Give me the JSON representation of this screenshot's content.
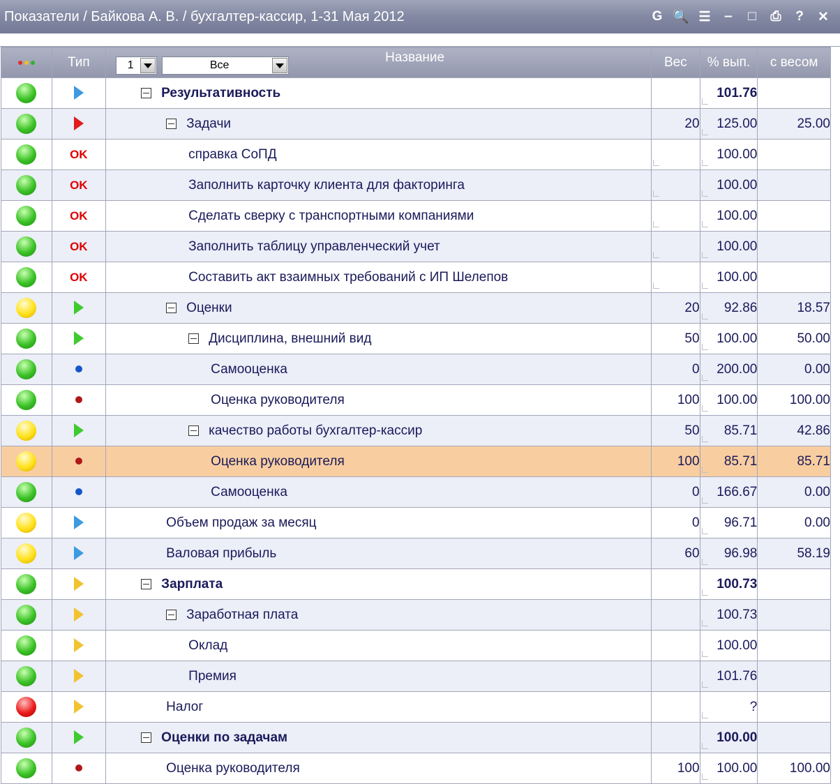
{
  "window": {
    "title": "Показатели / Байкова А. В. / бухгалтер-кассир, 1-31 Мая 2012",
    "toolbar": [
      {
        "name": "refresh-icon",
        "glyph": "G"
      },
      {
        "name": "search-icon",
        "glyph": "🔍"
      },
      {
        "name": "list-icon",
        "glyph": "☰"
      },
      {
        "name": "minimize-icon",
        "glyph": "‒"
      },
      {
        "name": "maximize-icon",
        "glyph": "□"
      },
      {
        "name": "print-icon",
        "glyph": "⎙"
      },
      {
        "name": "help-icon",
        "glyph": "?"
      },
      {
        "name": "close-icon",
        "glyph": "✕"
      }
    ]
  },
  "header": {
    "type": "Тип",
    "level_value": "1",
    "filter_value": "Все",
    "name": "Название",
    "weight": "Вес",
    "pct": "% вып.",
    "weighted": "с весом"
  },
  "rows": [
    {
      "status": "green",
      "type": "tri-blue",
      "indent": 0,
      "toggle": true,
      "bold": true,
      "name": "Результативность",
      "weight": "",
      "pct": "101.76",
      "weighted": ""
    },
    {
      "status": "green",
      "type": "tri-red",
      "indent": 1,
      "toggle": true,
      "bold": false,
      "name": "Задачи",
      "weight": "20",
      "pct": "125.00",
      "weighted": "25.00"
    },
    {
      "status": "green",
      "type": "ok",
      "indent": 2,
      "toggle": false,
      "bold": false,
      "name": "справка СоПД",
      "weight": "",
      "pct": "100.00",
      "weighted": ""
    },
    {
      "status": "green",
      "type": "ok",
      "indent": 2,
      "toggle": false,
      "bold": false,
      "name": "Заполнить карточку клиента для факторинга",
      "weight": "",
      "pct": "100.00",
      "weighted": ""
    },
    {
      "status": "green",
      "type": "ok",
      "indent": 2,
      "toggle": false,
      "bold": false,
      "name": "Сделать сверку с транспортными компаниями",
      "weight": "",
      "pct": "100.00",
      "weighted": ""
    },
    {
      "status": "green",
      "type": "ok",
      "indent": 2,
      "toggle": false,
      "bold": false,
      "name": "Заполнить таблицу управленческий учет",
      "weight": "",
      "pct": "100.00",
      "weighted": ""
    },
    {
      "status": "green",
      "type": "ok",
      "indent": 2,
      "toggle": false,
      "bold": false,
      "name": "Составить акт взаимных требований с ИП Шелепов",
      "weight": "",
      "pct": "100.00",
      "weighted": ""
    },
    {
      "status": "yellow",
      "type": "tri-green",
      "indent": 1,
      "toggle": true,
      "bold": false,
      "name": "Оценки",
      "weight": "20",
      "pct": "92.86",
      "weighted": "18.57"
    },
    {
      "status": "green",
      "type": "tri-green",
      "indent": 2,
      "toggle": true,
      "bold": false,
      "name": "Дисциплина, внешний вид",
      "weight": "50",
      "pct": "100.00",
      "weighted": "50.00"
    },
    {
      "status": "green",
      "type": "dot-blue",
      "indent": 3,
      "toggle": false,
      "bold": false,
      "name": "Самооценка",
      "weight": "0",
      "pct": "200.00",
      "weighted": "0.00"
    },
    {
      "status": "green",
      "type": "dot-darkred",
      "indent": 3,
      "toggle": false,
      "bold": false,
      "name": "Оценка руководителя",
      "weight": "100",
      "pct": "100.00",
      "weighted": "100.00"
    },
    {
      "status": "yellow",
      "type": "tri-green",
      "indent": 2,
      "toggle": true,
      "bold": false,
      "name": "качество работы бухгалтер-кассир",
      "weight": "50",
      "pct": "85.71",
      "weighted": "42.86"
    },
    {
      "status": "yellow",
      "type": "dot-darkred",
      "indent": 3,
      "toggle": false,
      "bold": false,
      "name": "Оценка руководителя",
      "weight": "100",
      "pct": "85.71",
      "weighted": "85.71",
      "highlight": true
    },
    {
      "status": "green",
      "type": "dot-blue",
      "indent": 3,
      "toggle": false,
      "bold": false,
      "name": "Самооценка",
      "weight": "0",
      "pct": "166.67",
      "weighted": "0.00"
    },
    {
      "status": "yellow",
      "type": "tri-blue",
      "indent": 1,
      "toggle": false,
      "bold": false,
      "name": "Объем продаж за месяц",
      "weight": "0",
      "pct": "96.71",
      "weighted": "0.00"
    },
    {
      "status": "yellow",
      "type": "tri-blue",
      "indent": 1,
      "toggle": false,
      "bold": false,
      "name": "Валовая прибыль",
      "weight": "60",
      "pct": "96.98",
      "weighted": "58.19"
    },
    {
      "status": "green",
      "type": "tri-yellow",
      "indent": 0,
      "toggle": true,
      "bold": true,
      "name": "Зарплата",
      "weight": "",
      "pct": "100.73",
      "weighted": ""
    },
    {
      "status": "green",
      "type": "tri-yellow",
      "indent": 1,
      "toggle": true,
      "bold": false,
      "name": "Заработная плата",
      "weight": "",
      "pct": "100.73",
      "weighted": ""
    },
    {
      "status": "green",
      "type": "tri-yellow",
      "indent": 2,
      "toggle": false,
      "bold": false,
      "name": "Оклад",
      "weight": "",
      "pct": "100.00",
      "weighted": ""
    },
    {
      "status": "green",
      "type": "tri-yellow",
      "indent": 2,
      "toggle": false,
      "bold": false,
      "name": "Премия",
      "weight": "",
      "pct": "101.76",
      "weighted": ""
    },
    {
      "status": "red",
      "type": "tri-yellow",
      "indent": 1,
      "toggle": false,
      "bold": false,
      "name": "Налог",
      "weight": "",
      "pct": "?",
      "weighted": ""
    },
    {
      "status": "green",
      "type": "tri-green",
      "indent": 0,
      "toggle": true,
      "bold": true,
      "name": "Оценки по задачам",
      "weight": "",
      "pct": "100.00",
      "weighted": ""
    },
    {
      "status": "green",
      "type": "dot-darkred",
      "indent": 1,
      "toggle": false,
      "bold": false,
      "name": "Оценка руководителя",
      "weight": "100",
      "pct": "100.00",
      "weighted": "100.00"
    }
  ]
}
